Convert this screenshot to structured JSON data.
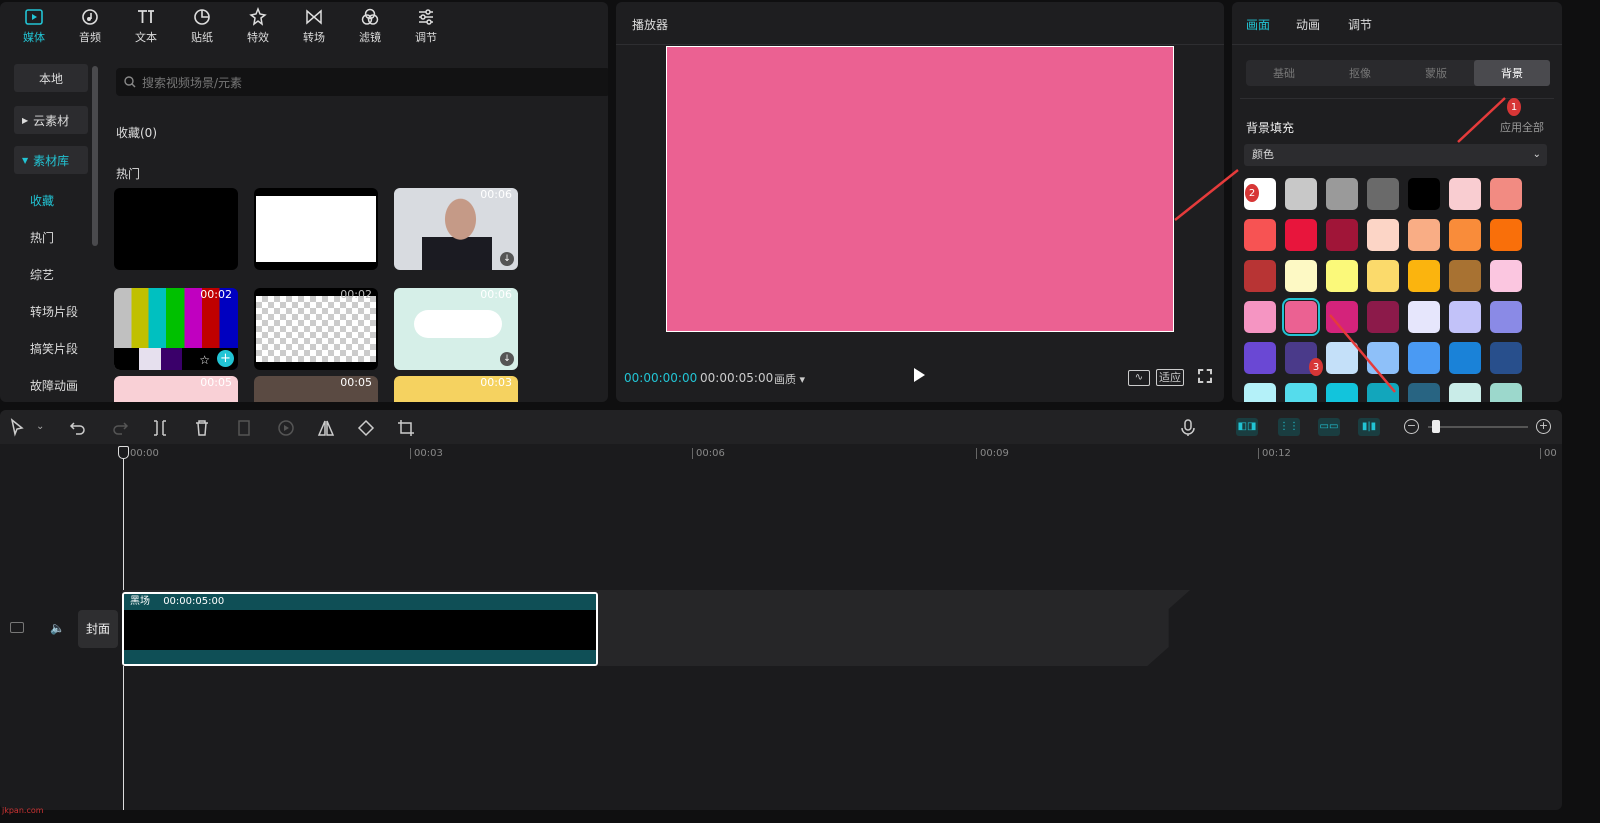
{
  "tool_tabs": [
    {
      "label": "媒体",
      "icon": "media-icon"
    },
    {
      "label": "音频",
      "icon": "audio-icon"
    },
    {
      "label": "文本",
      "icon": "text-icon"
    },
    {
      "label": "贴纸",
      "icon": "sticker-icon"
    },
    {
      "label": "特效",
      "icon": "effects-icon"
    },
    {
      "label": "转场",
      "icon": "transition-icon"
    },
    {
      "label": "滤镜",
      "icon": "filter-icon"
    },
    {
      "label": "调节",
      "icon": "adjust-icon"
    }
  ],
  "left_nav": {
    "local": "本地",
    "cloud": "云素材",
    "library": "素材库",
    "items": [
      "收藏",
      "热门",
      "综艺",
      "转场片段",
      "搞笑片段",
      "故障动画"
    ]
  },
  "search": {
    "placeholder": "搜索视频场景/元素"
  },
  "sections": {
    "favorites": "收藏(0)",
    "hot": "热门"
  },
  "thumbs": {
    "t3_dur": "00:06",
    "t4_dur": "00:02",
    "t6_dur": "00:02",
    "t7_dur": "00:06",
    "t8_dur": "00:05",
    "t9_dur": "00:03"
  },
  "player": {
    "title": "播放器",
    "current": "00:00:00:00",
    "total": "00:00:05:00",
    "quality": "画质",
    "fit": "适应"
  },
  "right": {
    "tabs": [
      "画面",
      "动画",
      "调节"
    ],
    "subtabs": [
      "基础",
      "抠像",
      "蒙版",
      "背景"
    ],
    "section": "背景填充",
    "apply_all": "应用全部",
    "fill_type": "颜色"
  },
  "swatches": [
    [
      "#ffffff",
      "#c8c8c8",
      "#9a9a9a",
      "#6a6a6a",
      "#000000",
      "#f9cdd1",
      "#f28b82"
    ],
    [
      "#f75353",
      "#e8153c",
      "#a01538",
      "#fcd5c6",
      "#f9ad85",
      "#f98c3a",
      "#f96f0a"
    ],
    [
      "#b83434",
      "#fdf9c4",
      "#fbf97a",
      "#fbda6b",
      "#fbb40e",
      "#a87232",
      "#fbc6e0"
    ],
    [
      "#f595c2",
      "#eb6192",
      "#d4237b",
      "#8c1a4a",
      "#e6e6fc",
      "#c2c2f9",
      "#8a8ae6"
    ],
    [
      "#6a48d4",
      "#4a3a8a",
      "#c4e0f9",
      "#8ec0f9",
      "#4a9af3",
      "#1a82d8",
      "#284f8c"
    ],
    [
      "#b4f1f9",
      "#55dcec",
      "#12c4dc",
      "#12a6bc",
      "#286482",
      "#c9ece8",
      "#9cd8cc"
    ]
  ],
  "markers": [
    "1",
    "2",
    "3"
  ],
  "timeline": {
    "ticks": [
      "00:00",
      "00:03",
      "00:06",
      "00:09",
      "00:12",
      "00"
    ],
    "clip_name": "黑场",
    "clip_dur": "00:00:05:00",
    "cover": "封面"
  },
  "watermark": "jkpan.com"
}
